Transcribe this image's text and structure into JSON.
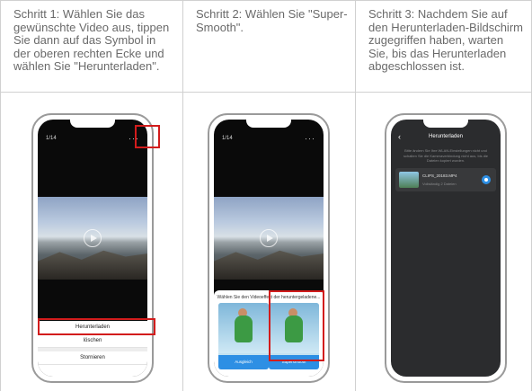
{
  "steps": [
    {
      "text": "Schritt 1: Wählen Sie das gewünschte Video aus, tippen Sie dann auf das Symbol in der oberen rechten Ecke und wählen Sie \"Herunterladen\"."
    },
    {
      "text": "Schritt 2: Wählen Sie \"Super-Smooth\"."
    },
    {
      "text": "Schritt 3:  Nachdem Sie auf den Herunterladen-Bildschirm zugegriffen haben, warten Sie, bis das Herunterladen abgeschlossen ist."
    }
  ],
  "phone1": {
    "counter": "1/14",
    "more_icon": "more-dots-icon",
    "menu": {
      "download": "Herunterladen",
      "delete": "löschen",
      "cancel": "Stornieren"
    }
  },
  "phone2": {
    "counter": "1/14",
    "sheet_title": "Wählen Sie den Videoeffekt der heruntergeladene...",
    "options": {
      "normal": "Ausgleich",
      "smooth": "Supersmooth"
    }
  },
  "phone3": {
    "title": "Herunterladen",
    "info": "Bitte ändern Sie Ihre WLAN-Einstellungen nicht und schalten Sie die Kameraverbindung nicht aus, bis die Dateien kopiert wurden.",
    "file_name": "CLIPS_20183.MP4",
    "file_status": "Vollständig 2 Dateien"
  },
  "colors": {
    "highlight": "#d21c1c",
    "accent": "#2d8fe4"
  }
}
